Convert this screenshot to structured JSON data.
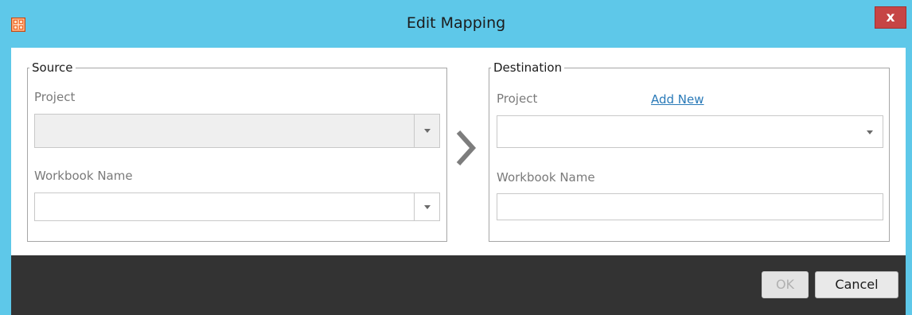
{
  "window": {
    "title": "Edit Mapping",
    "close_label": "x",
    "titlebar_color": "#5ec8e9",
    "close_color": "#c64545",
    "app_icon": "tableau-icon"
  },
  "source": {
    "legend": "Source",
    "project_label": "Project",
    "project_value": "",
    "project_disabled": true,
    "workbook_label": "Workbook Name",
    "workbook_value": ""
  },
  "arrow_icon": "chevron-right-icon",
  "destination": {
    "legend": "Destination",
    "project_label": "Project",
    "add_new_label": "Add New",
    "project_value": "",
    "workbook_label": "Workbook Name",
    "workbook_value": ""
  },
  "footer": {
    "ok_label": "OK",
    "ok_enabled": false,
    "cancel_label": "Cancel"
  }
}
